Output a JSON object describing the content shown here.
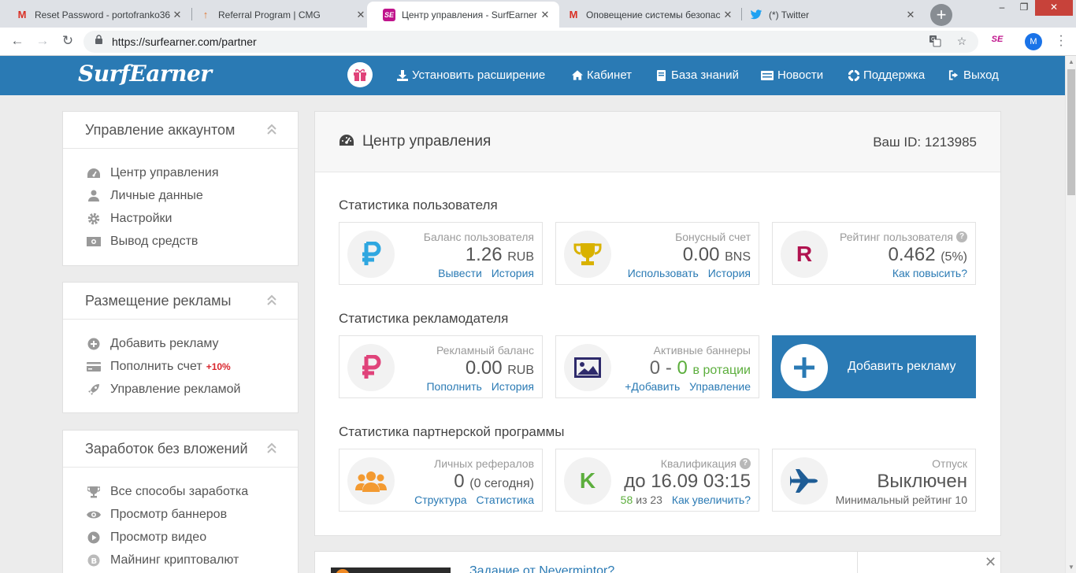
{
  "browser": {
    "tabs": [
      {
        "title": "Reset Password - portofranko36",
        "favicon": "gmail-icon"
      },
      {
        "title": "Referral Program | CMG",
        "favicon": "cmg-icon"
      },
      {
        "title": "Центр управления - SurfEarner",
        "favicon": "surfearner-icon",
        "active": true
      },
      {
        "title": "Оповещение системы безопас",
        "favicon": "gmail-icon"
      },
      {
        "title": "(*) Twitter",
        "favicon": "twitter-icon"
      }
    ],
    "new_tab": "+",
    "url": "https://surfearner.com/partner",
    "profile_initial": "M",
    "extension_label": "SE"
  },
  "header": {
    "logo": "SurfEarner",
    "nav": [
      {
        "label": "Установить расширение",
        "icon": "download-icon"
      },
      {
        "label": "Кабинет",
        "icon": "home-icon"
      },
      {
        "label": "База знаний",
        "icon": "book-icon"
      },
      {
        "label": "Новости",
        "icon": "newspaper-icon"
      },
      {
        "label": "Поддержка",
        "icon": "lifebuoy-icon"
      },
      {
        "label": "Выход",
        "icon": "sign-out-icon"
      }
    ]
  },
  "sidebar": {
    "account": {
      "title": "Управление аккаунтом",
      "items": [
        {
          "label": "Центр управления",
          "icon": "dashboard-icon"
        },
        {
          "label": "Личные данные",
          "icon": "user-icon"
        },
        {
          "label": "Настройки",
          "icon": "gear-icon"
        },
        {
          "label": "Вывод средств",
          "icon": "money-icon"
        }
      ]
    },
    "ads": {
      "title": "Размещение рекламы",
      "items": [
        {
          "label": "Добавить рекламу",
          "icon": "plus-circle-icon"
        },
        {
          "label": "Пополнить счет",
          "icon": "credit-card-icon",
          "promo": "+10%"
        },
        {
          "label": "Управление рекламой",
          "icon": "rocket-icon"
        }
      ]
    },
    "earn": {
      "title": "Заработок без вложений",
      "items": [
        {
          "label": "Все способы заработка",
          "icon": "trophy-icon"
        },
        {
          "label": "Просмотр баннеров",
          "icon": "eye-icon"
        },
        {
          "label": "Просмотр видео",
          "icon": "play-icon"
        },
        {
          "label": "Майнинг криптовалют",
          "icon": "bitcoin-icon"
        }
      ]
    }
  },
  "main": {
    "title": "Центр управления",
    "user_id_label": "Ваш ID:",
    "user_id": "1213985",
    "user_stats": {
      "title": "Статистика пользователя",
      "balance": {
        "label": "Баланс пользователя",
        "value": "1.26",
        "unit": "RUB",
        "link1": "Вывести",
        "link2": "История"
      },
      "bonus": {
        "label": "Бонусный счет",
        "value": "0.00",
        "unit": "BNS",
        "link1": "Использовать",
        "link2": "История"
      },
      "rating": {
        "label": "Рейтинг пользователя",
        "value": "0.462",
        "extra": "(5%)",
        "link1": "Как повысить?",
        "letter": "R"
      }
    },
    "advertiser_stats": {
      "title": "Статистика рекламодателя",
      "ad_balance": {
        "label": "Рекламный баланс",
        "value": "0.00",
        "unit": "RUB",
        "link1": "Пополнить",
        "link2": "История"
      },
      "banners": {
        "label": "Активные баннеры",
        "value_a": "0",
        "dash": "-",
        "value_b": "0",
        "suffix": "в ротации",
        "link1": "+Добавить",
        "link2": "Управление"
      },
      "add_ad": "Добавить рекламу"
    },
    "partner_stats": {
      "title": "Статистика партнерской программы",
      "referrals": {
        "label": "Личных рефералов",
        "value": "0",
        "extra": "(0 сегодня)",
        "link1": "Структура",
        "link2": "Статистика"
      },
      "qualification": {
        "label": "Квалификация",
        "value": "до 16.09 03:15",
        "num": "58",
        "of": "из 23",
        "link1": "Как увеличить?",
        "letter": "K"
      },
      "vacation": {
        "label": "Отпуск",
        "value": "Выключен",
        "sub": "Минимальный рейтинг 10"
      }
    }
  },
  "second_panel": {
    "title": "Задание от Nevermintor?"
  },
  "colors": {
    "brand": "#2a7ab4",
    "ruble_blue": "#2fa7e0",
    "ruble_pink": "#e0437a",
    "rating_crimson": "#b0124f",
    "trophy_gold": "#d9b200",
    "qualification_green": "#5cae3d",
    "referral_orange": "#f39a31",
    "promo_red": "#d9272e"
  }
}
